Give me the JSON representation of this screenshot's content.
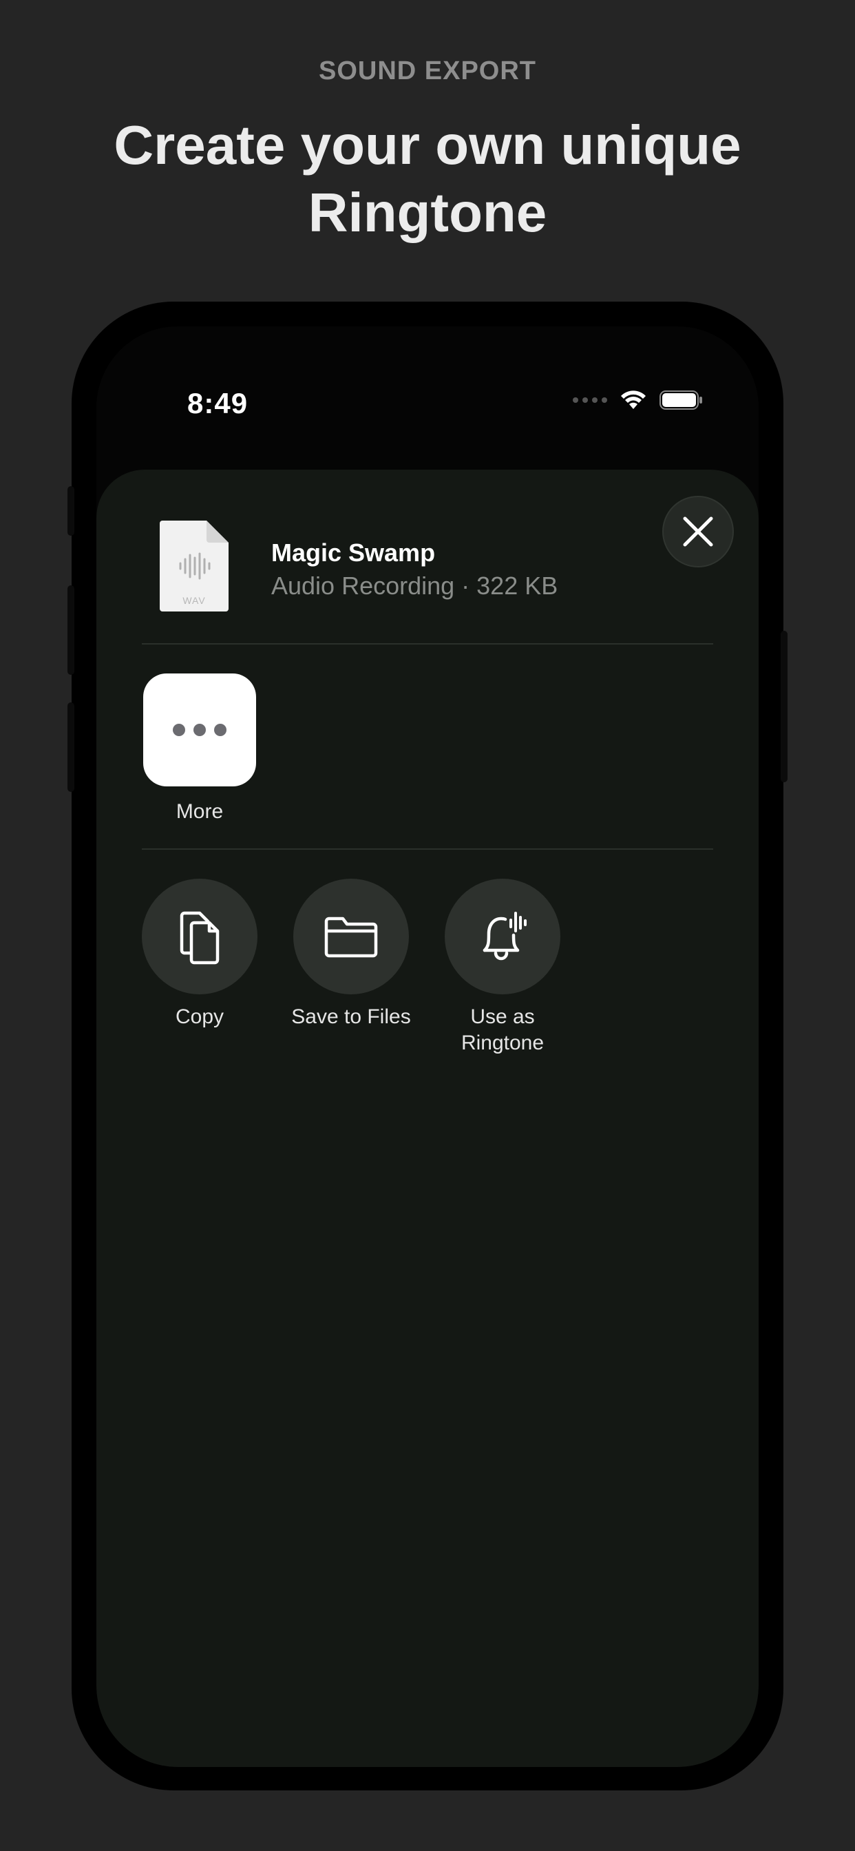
{
  "header": {
    "kicker": "SOUND EXPORT",
    "headline": "Create your own unique Ringtone"
  },
  "status_bar": {
    "time": "8:49",
    "icons": [
      "cellular-dots-icon",
      "wifi-icon",
      "battery-icon"
    ]
  },
  "share_sheet": {
    "file": {
      "title": "Magic Swamp",
      "subtitle": "Audio Recording · 322 KB",
      "type_label": "WAV",
      "icon": "waveform-document-icon"
    },
    "close_icon": "close-icon",
    "apps": [
      {
        "label": "More",
        "icon": "ellipsis-icon"
      }
    ],
    "actions": [
      {
        "label": "Copy",
        "icon": "copy-icon"
      },
      {
        "label": "Save to Files",
        "icon": "folder-icon"
      },
      {
        "label": "Use as Ringtone",
        "icon": "bell-icon"
      }
    ]
  },
  "colors": {
    "background": "#252525",
    "sheet": "#141814",
    "action_circle": "#2d312d",
    "headline": "#ececec",
    "kicker": "#8e8e8e"
  }
}
